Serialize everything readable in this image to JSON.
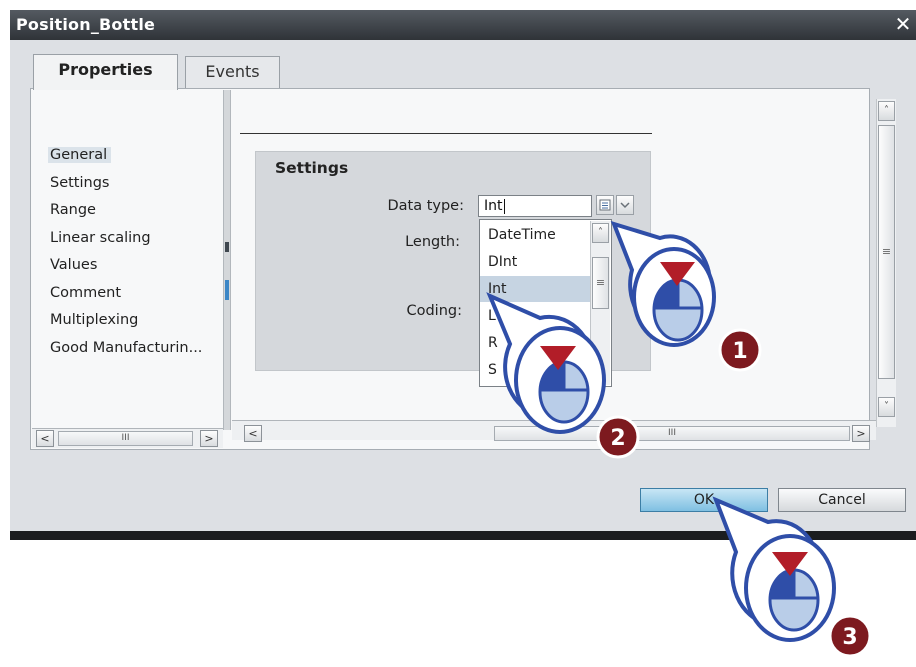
{
  "window": {
    "title": "Position_Bottle",
    "close_glyph": "✕"
  },
  "tabs": [
    {
      "label": "Properties",
      "active": true
    },
    {
      "label": "Events",
      "active": false
    }
  ],
  "nav": {
    "items": [
      {
        "label": "General",
        "selected": true
      },
      {
        "label": "Settings",
        "selected": false
      },
      {
        "label": "Range",
        "selected": false
      },
      {
        "label": "Linear scaling",
        "selected": false
      },
      {
        "label": "Values",
        "selected": false
      },
      {
        "label": "Comment",
        "selected": false
      },
      {
        "label": "Multiplexing",
        "selected": false
      },
      {
        "label": "Good Manufacturin...",
        "selected": false
      }
    ],
    "scroll_left": "<",
    "scroll_thumb": "III",
    "scroll_right": ">"
  },
  "settings": {
    "title": "Settings",
    "data_type_label": "Data type:",
    "data_type_value": "Int",
    "length_label": "Length:",
    "coding_label": "Coding:",
    "options": [
      {
        "label": "DateTime",
        "selected": false
      },
      {
        "label": "DInt",
        "selected": false
      },
      {
        "label": "Int",
        "selected": true
      },
      {
        "label": "L",
        "selected": false
      },
      {
        "label": "R",
        "selected": false
      },
      {
        "label": "S",
        "selected": false
      }
    ],
    "list_button_icon": "list-icon",
    "dropdown_icon": "chevron-down-icon"
  },
  "main_scroll": {
    "left": "<",
    "thumb": "III",
    "right": ">",
    "up": "˄",
    "down": "˅",
    "grip": "≡"
  },
  "footer": {
    "ok_label": "OK",
    "cancel_label": "Cancel"
  },
  "callouts": [
    {
      "number": "1",
      "target": "data-type-list-button"
    },
    {
      "number": "2",
      "target": "dropdown-option-int"
    },
    {
      "number": "3",
      "target": "ok-button"
    }
  ],
  "colors": {
    "titlebar": "#3a3f45",
    "ok_button": "#8ecbe8",
    "callout_ring": "#2f4ea8",
    "callout_badge": "#7d1a1f",
    "cursor_arrow": "#b21d28"
  }
}
